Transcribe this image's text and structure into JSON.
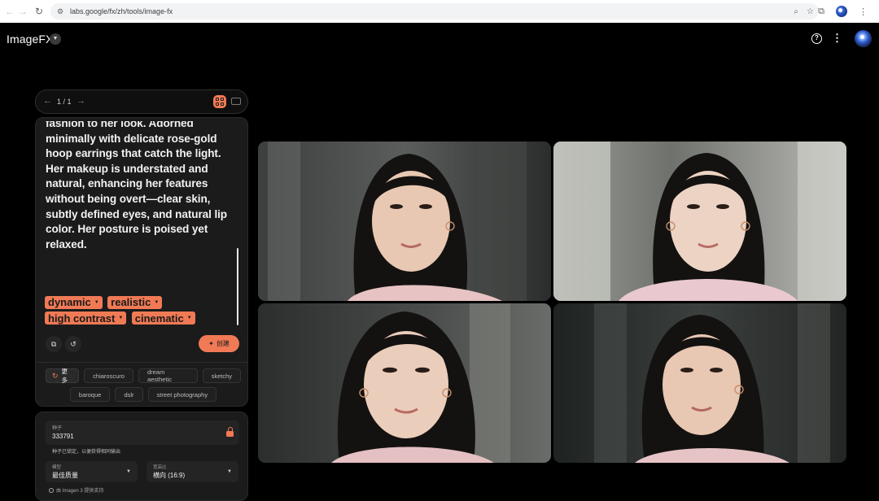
{
  "browser": {
    "url": "labs.google/fx/zh/tools/image-fx"
  },
  "app": {
    "title": "ImageFX"
  },
  "pager": {
    "count": "1 / 1"
  },
  "prompt": {
    "text": "fashion to her look. Adorned minimally with delicate rose-gold hoop earrings that catch the light. Her makeup is understated and natural, enhancing her features without being overt—clear skin, subtly defined eyes, and natural lip color. Her posture is poised yet relaxed.",
    "chips": [
      "dynamic",
      "realistic",
      "high contrast",
      "cinematic"
    ]
  },
  "actions": {
    "create_label": "创建"
  },
  "suggestions": {
    "more_label": "更多",
    "row1": [
      "chiaroscuro",
      "dream aesthetic",
      "sketchy"
    ],
    "row2": [
      "baroque",
      "dslr",
      "street photography"
    ]
  },
  "settings": {
    "seed_label": "种子",
    "seed_value": "333791",
    "seed_hint": "种子已锁定，以便获得相同输出",
    "model_label": "模型",
    "model_value": "最佳质量",
    "aspect_label": "宽高比",
    "aspect_value": "横向 (16:9)",
    "imagen_note": "由 Imagen 3 提供支持"
  },
  "images": {
    "count": 4
  }
}
